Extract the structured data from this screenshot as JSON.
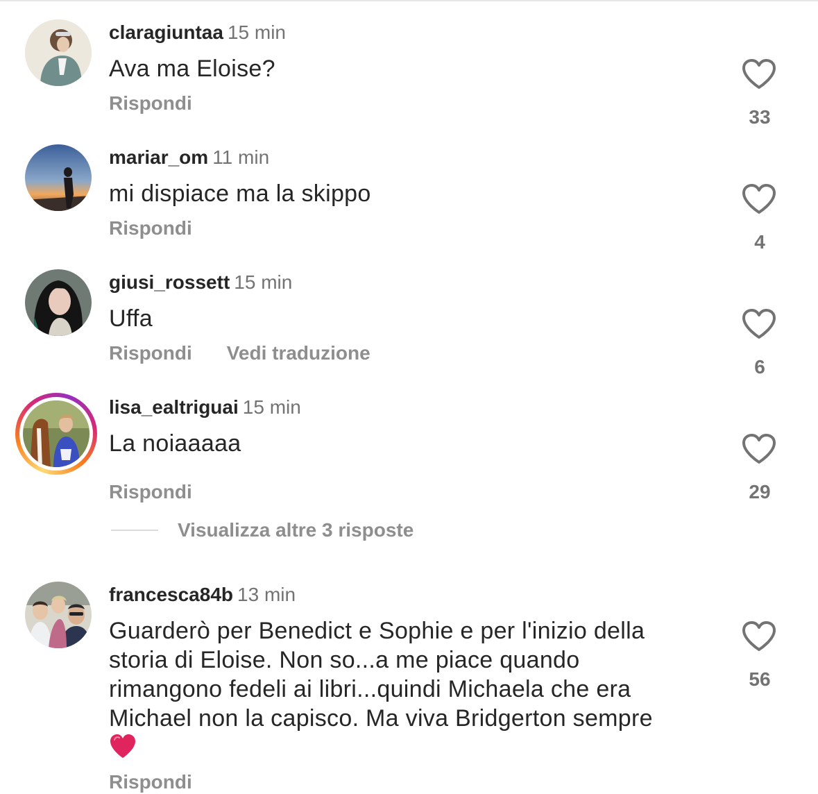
{
  "comments": [
    {
      "username": "claragiuntaa",
      "time": "15 min",
      "text": "Ava ma Eloise?",
      "reply_label": "Rispondi",
      "likes": "33",
      "has_story": false
    },
    {
      "username": "mariar_om",
      "time": "11 min",
      "text": "mi dispiace ma la skippo",
      "reply_label": "Rispondi",
      "likes": "4",
      "has_story": false
    },
    {
      "username": "giusi_rossett",
      "time": "15 min",
      "text": "Uffa",
      "reply_label": "Rispondi",
      "translate_label": "Vedi traduzione",
      "likes": "6",
      "has_story": false
    },
    {
      "username": "lisa_ealtriguai",
      "time": "15 min",
      "text": "La noiaaaaa",
      "reply_label": "Rispondi",
      "likes": "29",
      "has_story": true
    },
    {
      "username": "francesca84b",
      "time": "13 min",
      "text": "Guarderò per Benedict e Sophie e per l'inizio della storia di Eloise. Non so...a me piace quando rimangono fedeli ai libri...quindi Michaela che era Michael non la capisco. Ma viva Bridgerton sempre",
      "text_emoji": "red-heart",
      "reply_label": "Rispondi",
      "likes": "56",
      "has_story": false
    }
  ],
  "more_replies_label": "Visualizza altre 3 risposte",
  "icons": {
    "like": "heart-outline-icon",
    "emoji": "red-heart-emoji"
  },
  "colors": {
    "text": "#262626",
    "secondary": "#8e8e8e",
    "time": "#737373",
    "emoji_heart": "#e0245e"
  }
}
